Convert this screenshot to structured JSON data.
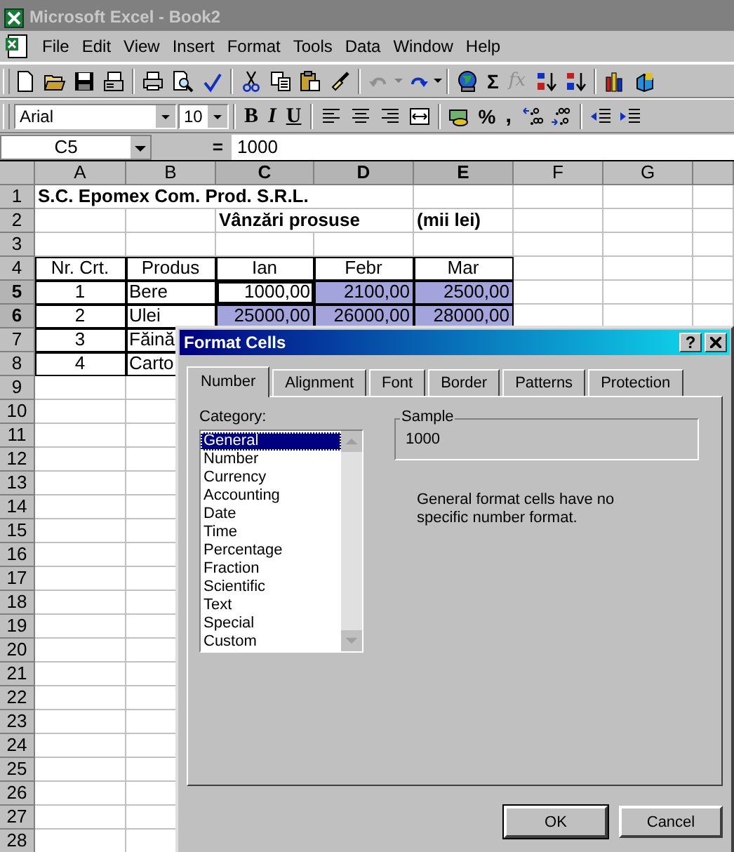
{
  "window": {
    "title": "Microsoft Excel - Book2"
  },
  "menu": [
    {
      "label": "File"
    },
    {
      "label": "Edit"
    },
    {
      "label": "View"
    },
    {
      "label": "Insert"
    },
    {
      "label": "Format"
    },
    {
      "label": "Tools"
    },
    {
      "label": "Data"
    },
    {
      "label": "Window"
    },
    {
      "label": "Help"
    }
  ],
  "standard_toolbar": {
    "undo": {
      "disabled": true
    },
    "redo": {
      "disabled": false
    },
    "autosum": "Σ",
    "function": {
      "label": "fx",
      "disabled": true
    }
  },
  "formatting_toolbar": {
    "font": "Arial",
    "size": "10",
    "bold": "B",
    "italic": "I",
    "underline": "U",
    "percent": "%",
    "comma": ","
  },
  "formula_bar": {
    "name_box": "C5",
    "equals": "=",
    "content": "1000"
  },
  "sheet": {
    "columns": [
      {
        "label": "A",
        "selected": false
      },
      {
        "label": "B",
        "selected": false
      },
      {
        "label": "C",
        "selected": true
      },
      {
        "label": "D",
        "selected": true
      },
      {
        "label": "E",
        "selected": true
      },
      {
        "label": "F",
        "selected": false
      },
      {
        "label": "G",
        "selected": false
      }
    ],
    "rows": [
      {
        "number": "1",
        "selected": false,
        "a": {
          "text": "S.C. Epomex Com. Prod. S.R.L.",
          "bold": true,
          "selected": false
        }
      },
      {
        "number": "2",
        "selected": false,
        "c": {
          "text": "Vânzări prosuse",
          "bold": true,
          "selected": false
        },
        "e": {
          "text": "(mii lei)",
          "bold": true,
          "selected": false
        }
      },
      {
        "number": "3",
        "selected": false
      },
      {
        "number": "4",
        "selected": false,
        "a": {
          "text": "Nr. Crt.",
          "boxed": true,
          "selected": false
        },
        "b": {
          "text": "Produs",
          "boxed": true,
          "selected": false
        },
        "c": {
          "text": "Ian",
          "boxed": true,
          "selected": false
        },
        "d": {
          "text": "Febr",
          "boxed": true,
          "selected": false
        },
        "e": {
          "text": "Mar",
          "boxed": true,
          "selected": false
        }
      },
      {
        "number": "5",
        "selected": true,
        "a": {
          "text": "1",
          "boxed": true,
          "selected": false
        },
        "b": {
          "text": "Bere",
          "boxed": true,
          "selected": false
        },
        "c": {
          "text": "1000,00",
          "boxed": true,
          "active": true
        },
        "d": {
          "text": "2100,00",
          "boxed": true,
          "selected": true
        },
        "e": {
          "text": "2500,00",
          "boxed": true,
          "selected": true
        }
      },
      {
        "number": "6",
        "selected": true,
        "a": {
          "text": "2",
          "boxed": true,
          "selected": false
        },
        "b": {
          "text": "Ulei",
          "boxed": true,
          "selected": false
        },
        "c": {
          "text": "25000,00",
          "boxed": true,
          "selected": true
        },
        "d": {
          "text": "26000,00",
          "boxed": true,
          "selected": true
        },
        "e": {
          "text": "28000,00",
          "boxed": true,
          "selected": true
        }
      },
      {
        "number": "7",
        "selected": false,
        "a": {
          "text": "3",
          "boxed": true,
          "selected": false
        },
        "b": {
          "text": "Făină",
          "boxed": true,
          "selected": false
        }
      },
      {
        "number": "8",
        "selected": false,
        "a": {
          "text": "4",
          "boxed": true,
          "selected": false
        },
        "b": {
          "text": "Carto",
          "boxed": true,
          "selected": false
        }
      },
      {
        "number": "9",
        "selected": false
      },
      {
        "number": "10",
        "selected": false
      },
      {
        "number": "11",
        "selected": false
      },
      {
        "number": "12",
        "selected": false
      },
      {
        "number": "13",
        "selected": false
      },
      {
        "number": "14",
        "selected": false
      },
      {
        "number": "15",
        "selected": false
      },
      {
        "number": "16",
        "selected": false
      },
      {
        "number": "17",
        "selected": false
      },
      {
        "number": "18",
        "selected": false
      },
      {
        "number": "19",
        "selected": false
      },
      {
        "number": "20",
        "selected": false
      },
      {
        "number": "21",
        "selected": false
      },
      {
        "number": "22",
        "selected": false
      },
      {
        "number": "23",
        "selected": false
      },
      {
        "number": "24",
        "selected": false
      },
      {
        "number": "25",
        "selected": false
      },
      {
        "number": "26",
        "selected": false
      },
      {
        "number": "27",
        "selected": false
      },
      {
        "number": "28",
        "selected": false
      }
    ]
  },
  "dialog": {
    "title": "Format Cells",
    "help": "?",
    "tabs": [
      {
        "label": "Number",
        "selected": true
      },
      {
        "label": "Alignment",
        "selected": false
      },
      {
        "label": "Font",
        "selected": false
      },
      {
        "label": "Border",
        "selected": false
      },
      {
        "label": "Patterns",
        "selected": false
      },
      {
        "label": "Protection",
        "selected": false
      }
    ],
    "category_label": "Category:",
    "categories": [
      {
        "label": "General",
        "selected": true
      },
      {
        "label": "Number",
        "selected": false
      },
      {
        "label": "Currency",
        "selected": false
      },
      {
        "label": "Accounting",
        "selected": false
      },
      {
        "label": "Date",
        "selected": false
      },
      {
        "label": "Time",
        "selected": false
      },
      {
        "label": "Percentage",
        "selected": false
      },
      {
        "label": "Fraction",
        "selected": false
      },
      {
        "label": "Scientific",
        "selected": false
      },
      {
        "label": "Text",
        "selected": false
      },
      {
        "label": "Special",
        "selected": false
      },
      {
        "label": "Custom",
        "selected": false
      }
    ],
    "sample": {
      "label": "Sample",
      "value": "1000"
    },
    "description": "General format cells have no specific number format.",
    "buttons": [
      {
        "label": "OK",
        "default": true
      },
      {
        "label": "Cancel",
        "default": false
      }
    ]
  }
}
